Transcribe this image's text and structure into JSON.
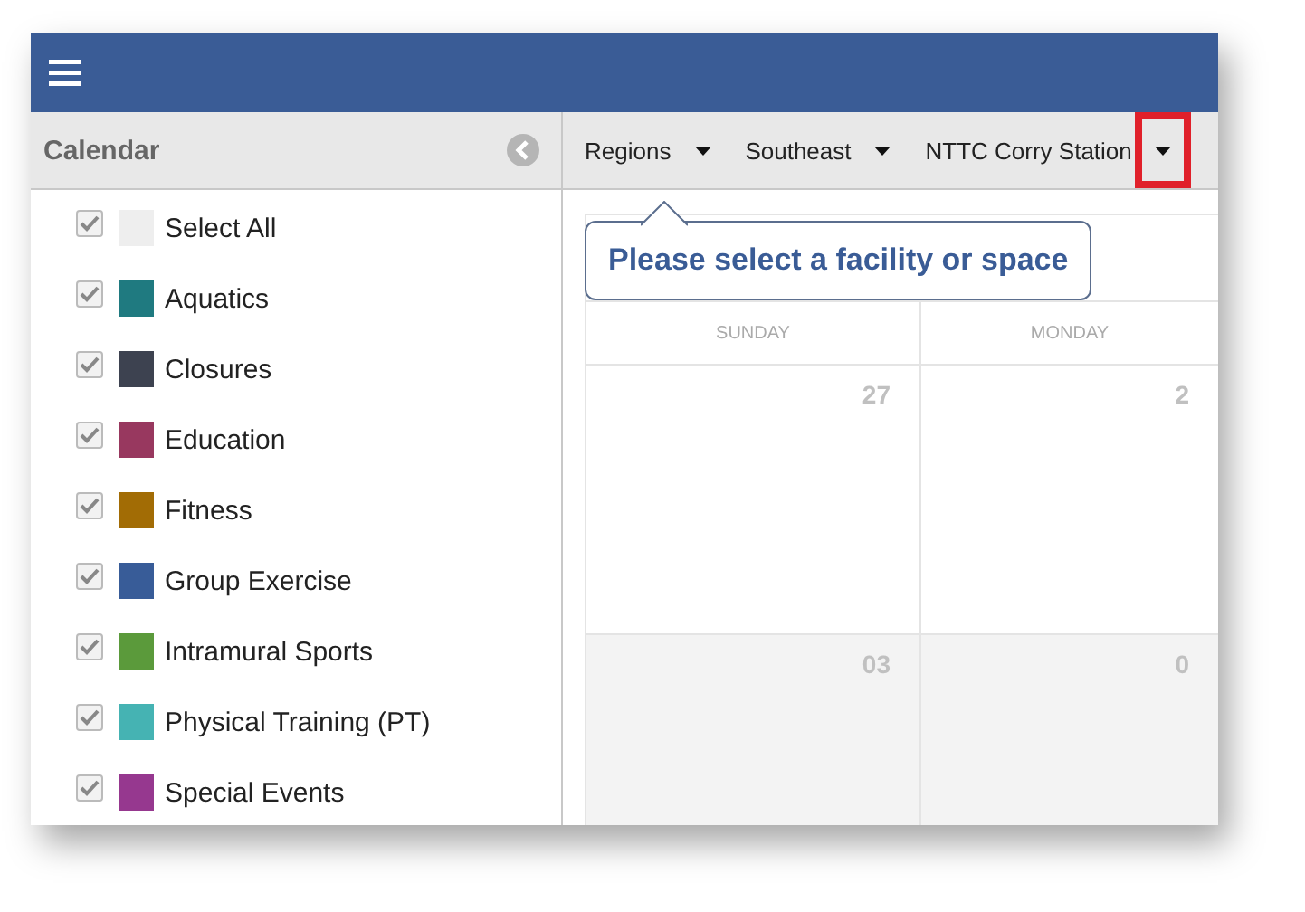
{
  "sidebar": {
    "title": "Calendar",
    "items": [
      {
        "label": "Select All",
        "checked": true,
        "color": "#eeeeee"
      },
      {
        "label": "Aquatics",
        "checked": true,
        "color": "#1f7a80"
      },
      {
        "label": "Closures",
        "checked": true,
        "color": "#3d4250"
      },
      {
        "label": "Education",
        "checked": true,
        "color": "#98385f"
      },
      {
        "label": "Fitness",
        "checked": true,
        "color": "#a26c05"
      },
      {
        "label": "Group Exercise",
        "checked": true,
        "color": "#385c98"
      },
      {
        "label": "Intramural Sports",
        "checked": true,
        "color": "#5b9a3b"
      },
      {
        "label": "Physical Training (PT)",
        "checked": true,
        "color": "#45b3b3"
      },
      {
        "label": "Special Events",
        "checked": true,
        "color": "#96388f"
      }
    ]
  },
  "filters": [
    {
      "label": "Regions",
      "highlighted": false
    },
    {
      "label": "Southeast",
      "highlighted": false
    },
    {
      "label": "NTTC Corry Station",
      "highlighted": true
    }
  ],
  "tooltip": "Please select a facility or space",
  "calendar": {
    "days": [
      "SUNDAY",
      "MONDAY"
    ],
    "weeks": [
      {
        "dates": [
          "27",
          "2"
        ],
        "shaded": false
      },
      {
        "dates": [
          "03",
          "0"
        ],
        "shaded": true
      }
    ]
  }
}
